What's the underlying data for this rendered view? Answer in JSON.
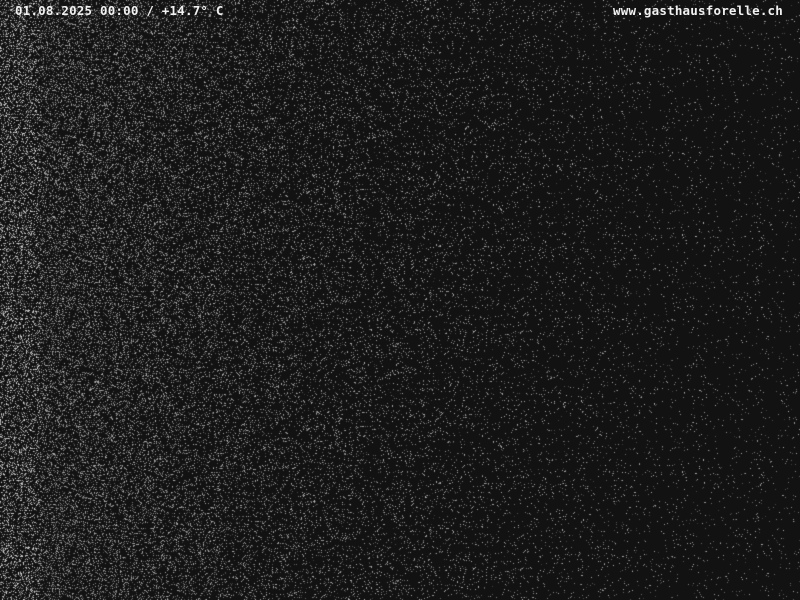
{
  "webcam": {
    "timestamp_line": "01.08.2025 00:00 / +14.7° C",
    "website": "www.gasthausforelle.ch",
    "background_color": "#121212",
    "text_color": "#f2f2f2",
    "scene": "night-sensor-noise"
  }
}
